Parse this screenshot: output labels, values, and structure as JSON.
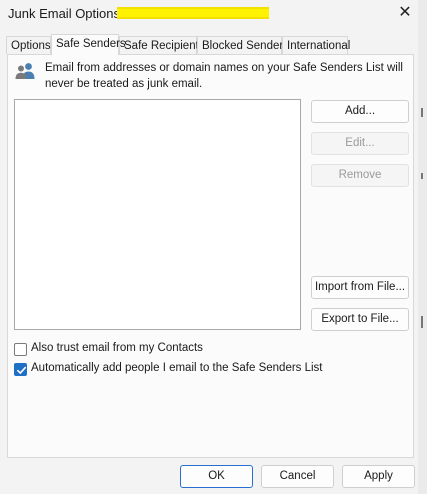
{
  "window": {
    "title": "Junk Email Options -"
  },
  "tabs": [
    {
      "label": "Options",
      "active": false
    },
    {
      "label": "Safe Senders",
      "active": true
    },
    {
      "label": "Safe Recipients",
      "active": false
    },
    {
      "label": "Blocked Senders",
      "active": false
    },
    {
      "label": "International",
      "active": false
    }
  ],
  "panel": {
    "icon": "people-icon",
    "description": "Email from addresses or domain names on your Safe Senders List will never be treated as junk email.",
    "buttons": {
      "add": "Add...",
      "edit": "Edit...",
      "remove": "Remove",
      "import": "Import from File...",
      "export": "Export to File..."
    },
    "checkboxes": {
      "trust_contacts": {
        "label": "Also trust email from my Contacts",
        "checked": false
      },
      "auto_add": {
        "label": "Automatically add people I email to the Safe Senders List",
        "checked": true
      }
    }
  },
  "footer": {
    "ok": "OK",
    "cancel": "Cancel",
    "apply": "Apply"
  },
  "colors": {
    "accent": "#1f6fc5",
    "redaction": "#fff200"
  }
}
